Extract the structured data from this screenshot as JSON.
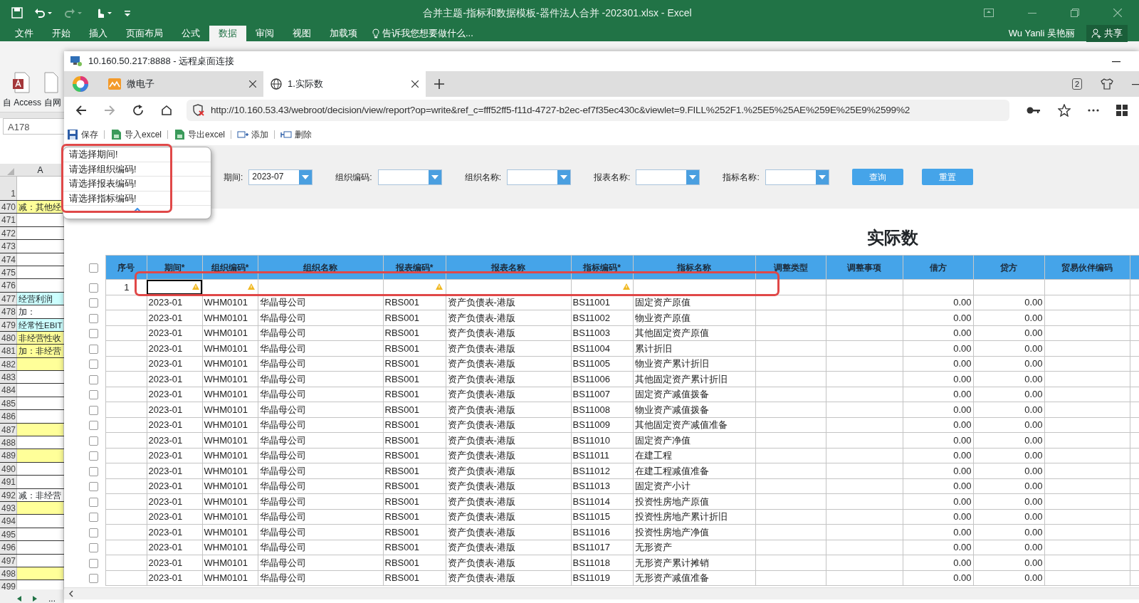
{
  "excel": {
    "title": "合并主题-指标和数据模板-器件法人合并 -202301.xlsx - Excel",
    "ribbon_tabs": [
      {
        "label": "文件",
        "selected": false
      },
      {
        "label": "开始",
        "selected": false
      },
      {
        "label": "插入",
        "selected": false
      },
      {
        "label": "页面布局",
        "selected": false
      },
      {
        "label": "公式",
        "selected": false
      },
      {
        "label": "数据",
        "selected": true
      },
      {
        "label": "审阅",
        "selected": false
      },
      {
        "label": "视图",
        "selected": false
      },
      {
        "label": "加载项",
        "selected": false
      }
    ],
    "tell_me": "告诉我您想要做什么...",
    "user": "Wu Yanli 吴艳丽",
    "share": "共享",
    "ribbon_buttons": [
      "自 Access",
      "自网"
    ],
    "name_box": "A178",
    "column_header": "A",
    "first_row": "1",
    "rows": [
      {
        "number": "470",
        "text": "减：其他经",
        "color": "#ffff99"
      },
      {
        "number": "471",
        "color": "#ffffff"
      },
      {
        "number": "472",
        "color": "#ffffff"
      },
      {
        "number": "473",
        "color": "#ffffff"
      },
      {
        "number": "474",
        "color": "#ffffff"
      },
      {
        "number": "475",
        "color": "#ffffff"
      },
      {
        "number": "476",
        "color": "#ffffff"
      },
      {
        "number": "477",
        "text": "经营利润",
        "color": "#ccffff"
      },
      {
        "number": "478",
        "text": "加：",
        "color": "#ffffff"
      },
      {
        "number": "479",
        "text": "经常性EBIT",
        "color": "#ccffff"
      },
      {
        "number": "480",
        "text": "非经营性收",
        "color": "#ffff99"
      },
      {
        "number": "481",
        "text": "加：非经营",
        "color": "#ffff99"
      },
      {
        "number": "482",
        "color": "#ffff99"
      },
      {
        "number": "483",
        "color": "#ffffff"
      },
      {
        "number": "484",
        "color": "#ffffff"
      },
      {
        "number": "485",
        "color": "#ffffff"
      },
      {
        "number": "486",
        "color": "#ffffff"
      },
      {
        "number": "487",
        "color": "#ffff99"
      },
      {
        "number": "488",
        "color": "#ffffff"
      },
      {
        "number": "489",
        "color": "#ffff99"
      },
      {
        "number": "490",
        "color": "#ffffff"
      },
      {
        "number": "491",
        "color": "#ffffff"
      },
      {
        "number": "492",
        "text": "减：非经营",
        "color": "#ffffff"
      },
      {
        "number": "493",
        "color": "#ffff99"
      },
      {
        "number": "494",
        "color": "#ffffff"
      },
      {
        "number": "495",
        "color": "#ffffff"
      },
      {
        "number": "496",
        "color": "#ffffff"
      },
      {
        "number": "497",
        "color": "#ffffff"
      },
      {
        "number": "498",
        "color": "#ffff99"
      },
      {
        "number": "499",
        "color": "#ffffff"
      }
    ],
    "sheet_nav_more": "..."
  },
  "remote_window": {
    "title": "10.160.50.217:8888 - 远程桌面连接"
  },
  "browser": {
    "tabs": [
      {
        "label": "微电子",
        "selected": false
      },
      {
        "label": "1.实际数",
        "selected": true
      }
    ],
    "tab_count": "2",
    "url": "http://10.160.53.43/webroot/decision/view/report?op=write&ref_c=fff52ff5-f11d-4727-b2ec-ef7f35ec430c&viewlet=9.FILL%252F1.%25E5%25AE%259E%25E9%2599%2"
  },
  "report": {
    "toolbar": [
      "保存",
      "导入excel",
      "导出excel",
      "添加",
      "删除"
    ],
    "filters": [
      {
        "label": "期间:",
        "value": "2023-07"
      },
      {
        "label": "组织编码:"
      },
      {
        "label": "组织名称:"
      },
      {
        "label": "报表名称:"
      },
      {
        "label": "指标名称:"
      }
    ],
    "buttons": [
      "查询",
      "重置"
    ],
    "validation_messages": [
      "请选择期间!",
      "请选择组织编码!",
      "请选择报表编码!",
      "请选择指标编码!"
    ],
    "title": "实际数",
    "table": {
      "header_checked": false,
      "columns": [
        "序号",
        "期间*",
        "组织编码*",
        "组织名称",
        "报表编码*",
        "报表名称",
        "指标编码*",
        "指标名称",
        "调整类型",
        "调整事项",
        "借方",
        "贷方",
        "贸易伙伴编码"
      ],
      "input_row": {
        "index": "1",
        "checked": false,
        "warnings": [
          false,
          true,
          true,
          false,
          true,
          false,
          true,
          false,
          false,
          false,
          false,
          false,
          false
        ],
        "focused": [
          false,
          true,
          false,
          false,
          false,
          false,
          false,
          false,
          false,
          false,
          false,
          false,
          false
        ]
      },
      "rows": [
        {
          "checked": false,
          "period": "2023-01",
          "org_code": "WHM0101",
          "org_name": "华晶母公司",
          "report_code": "RBS001",
          "report_name": "资产负债表-港版",
          "indicator_code": "BS11001",
          "indicator_name": "固定资产原值",
          "debit": "0.00",
          "credit": "0.00"
        },
        {
          "checked": false,
          "period": "2023-01",
          "org_code": "WHM0101",
          "org_name": "华晶母公司",
          "report_code": "RBS001",
          "report_name": "资产负债表-港版",
          "indicator_code": "BS11002",
          "indicator_name": "物业资产原值",
          "debit": "0.00",
          "credit": "0.00"
        },
        {
          "checked": false,
          "period": "2023-01",
          "org_code": "WHM0101",
          "org_name": "华晶母公司",
          "report_code": "RBS001",
          "report_name": "资产负债表-港版",
          "indicator_code": "BS11003",
          "indicator_name": "其他固定资产原值",
          "debit": "0.00",
          "credit": "0.00"
        },
        {
          "checked": false,
          "period": "2023-01",
          "org_code": "WHM0101",
          "org_name": "华晶母公司",
          "report_code": "RBS001",
          "report_name": "资产负债表-港版",
          "indicator_code": "BS11004",
          "indicator_name": "累计折旧",
          "debit": "0.00",
          "credit": "0.00"
        },
        {
          "checked": false,
          "period": "2023-01",
          "org_code": "WHM0101",
          "org_name": "华晶母公司",
          "report_code": "RBS001",
          "report_name": "资产负债表-港版",
          "indicator_code": "BS11005",
          "indicator_name": "物业资产累计折旧",
          "debit": "0.00",
          "credit": "0.00"
        },
        {
          "checked": false,
          "period": "2023-01",
          "org_code": "WHM0101",
          "org_name": "华晶母公司",
          "report_code": "RBS001",
          "report_name": "资产负债表-港版",
          "indicator_code": "BS11006",
          "indicator_name": "其他固定资产累计折旧",
          "debit": "0.00",
          "credit": "0.00"
        },
        {
          "checked": false,
          "period": "2023-01",
          "org_code": "WHM0101",
          "org_name": "华晶母公司",
          "report_code": "RBS001",
          "report_name": "资产负债表-港版",
          "indicator_code": "BS11007",
          "indicator_name": "固定资产减值拨备",
          "debit": "0.00",
          "credit": "0.00"
        },
        {
          "checked": false,
          "period": "2023-01",
          "org_code": "WHM0101",
          "org_name": "华晶母公司",
          "report_code": "RBS001",
          "report_name": "资产负债表-港版",
          "indicator_code": "BS11008",
          "indicator_name": "物业资产减值拨备",
          "debit": "0.00",
          "credit": "0.00"
        },
        {
          "checked": false,
          "period": "2023-01",
          "org_code": "WHM0101",
          "org_name": "华晶母公司",
          "report_code": "RBS001",
          "report_name": "资产负债表-港版",
          "indicator_code": "BS11009",
          "indicator_name": "其他固定资产减值准备",
          "debit": "0.00",
          "credit": "0.00"
        },
        {
          "checked": false,
          "period": "2023-01",
          "org_code": "WHM0101",
          "org_name": "华晶母公司",
          "report_code": "RBS001",
          "report_name": "资产负债表-港版",
          "indicator_code": "BS11010",
          "indicator_name": "固定资产净值",
          "debit": "0.00",
          "credit": "0.00"
        },
        {
          "checked": false,
          "period": "2023-01",
          "org_code": "WHM0101",
          "org_name": "华晶母公司",
          "report_code": "RBS001",
          "report_name": "资产负债表-港版",
          "indicator_code": "BS11011",
          "indicator_name": "在建工程",
          "debit": "0.00",
          "credit": "0.00"
        },
        {
          "checked": false,
          "period": "2023-01",
          "org_code": "WHM0101",
          "org_name": "华晶母公司",
          "report_code": "RBS001",
          "report_name": "资产负债表-港版",
          "indicator_code": "BS11012",
          "indicator_name": "在建工程减值准备",
          "debit": "0.00",
          "credit": "0.00"
        },
        {
          "checked": false,
          "period": "2023-01",
          "org_code": "WHM0101",
          "org_name": "华晶母公司",
          "report_code": "RBS001",
          "report_name": "资产负债表-港版",
          "indicator_code": "BS11013",
          "indicator_name": "固定资产小计",
          "debit": "0.00",
          "credit": "0.00"
        },
        {
          "checked": false,
          "period": "2023-01",
          "org_code": "WHM0101",
          "org_name": "华晶母公司",
          "report_code": "RBS001",
          "report_name": "资产负债表-港版",
          "indicator_code": "BS11014",
          "indicator_name": "投资性房地产原值",
          "debit": "0.00",
          "credit": "0.00"
        },
        {
          "checked": false,
          "period": "2023-01",
          "org_code": "WHM0101",
          "org_name": "华晶母公司",
          "report_code": "RBS001",
          "report_name": "资产负债表-港版",
          "indicator_code": "BS11015",
          "indicator_name": "投资性房地产累计折旧",
          "debit": "0.00",
          "credit": "0.00"
        },
        {
          "checked": false,
          "period": "2023-01",
          "org_code": "WHM0101",
          "org_name": "华晶母公司",
          "report_code": "RBS001",
          "report_name": "资产负债表-港版",
          "indicator_code": "BS11016",
          "indicator_name": "投资性房地产净值",
          "debit": "0.00",
          "credit": "0.00"
        },
        {
          "checked": false,
          "period": "2023-01",
          "org_code": "WHM0101",
          "org_name": "华晶母公司",
          "report_code": "RBS001",
          "report_name": "资产负债表-港版",
          "indicator_code": "BS11017",
          "indicator_name": "无形资产",
          "debit": "0.00",
          "credit": "0.00"
        },
        {
          "checked": false,
          "period": "2023-01",
          "org_code": "WHM0101",
          "org_name": "华晶母公司",
          "report_code": "RBS001",
          "report_name": "资产负债表-港版",
          "indicator_code": "BS11018",
          "indicator_name": "无形资产累计摊销",
          "debit": "0.00",
          "credit": "0.00"
        },
        {
          "checked": false,
          "period": "2023-01",
          "org_code": "WHM0101",
          "org_name": "华晶母公司",
          "report_code": "RBS001",
          "report_name": "资产负债表-港版",
          "indicator_code": "BS11019",
          "indicator_name": "无形资产减值准备",
          "debit": "0.00",
          "credit": "0.00"
        }
      ]
    }
  }
}
